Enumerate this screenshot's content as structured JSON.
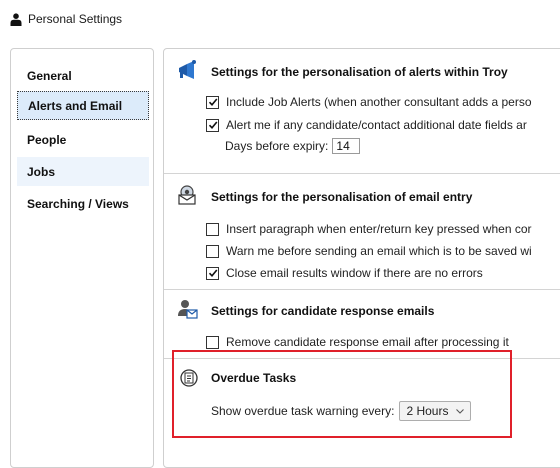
{
  "window": {
    "title": "Personal Settings",
    "icon": "person-icon"
  },
  "nav": {
    "items": [
      {
        "label": "General",
        "state": "normal"
      },
      {
        "label": "Alerts and Email",
        "state": "selected"
      },
      {
        "label": "People",
        "state": "normal"
      },
      {
        "label": "Jobs",
        "state": "hover"
      },
      {
        "label": "Searching / Views",
        "state": "normal"
      }
    ]
  },
  "sections": {
    "alerts": {
      "title": "Settings for the personalisation of alerts within Troy",
      "icon": "megaphone-icon",
      "options": [
        {
          "label": "Include Job Alerts (when another consultant adds a perso",
          "checked": true
        },
        {
          "label": "Alert me if any candidate/contact additional date fields ar",
          "checked": true
        }
      ],
      "days_label": "Days before expiry:",
      "days_value": "14"
    },
    "email": {
      "title": "Settings for the personalisation of email entry",
      "icon": "email-settings-icon",
      "options": [
        {
          "label": "Insert paragraph when enter/return key pressed when cor",
          "checked": false
        },
        {
          "label": "Warn me before sending an email which is to be saved wi",
          "checked": false
        },
        {
          "label": "Close email results window if there are no errors",
          "checked": true
        }
      ]
    },
    "candidate": {
      "title": "Settings for candidate response emails",
      "icon": "candidate-response-icon",
      "options": [
        {
          "label": "Remove candidate response email after processing it",
          "checked": false
        }
      ]
    },
    "overdue": {
      "title": "Overdue Tasks",
      "icon": "overdue-task-icon",
      "label": "Show overdue task warning every:",
      "selected": "2 Hours"
    }
  },
  "colors": {
    "highlight": "#e0202a",
    "selected_bg": "#dcebfa",
    "hover_bg": "#edf4fc",
    "icon_blue": "#1e5aa8"
  }
}
